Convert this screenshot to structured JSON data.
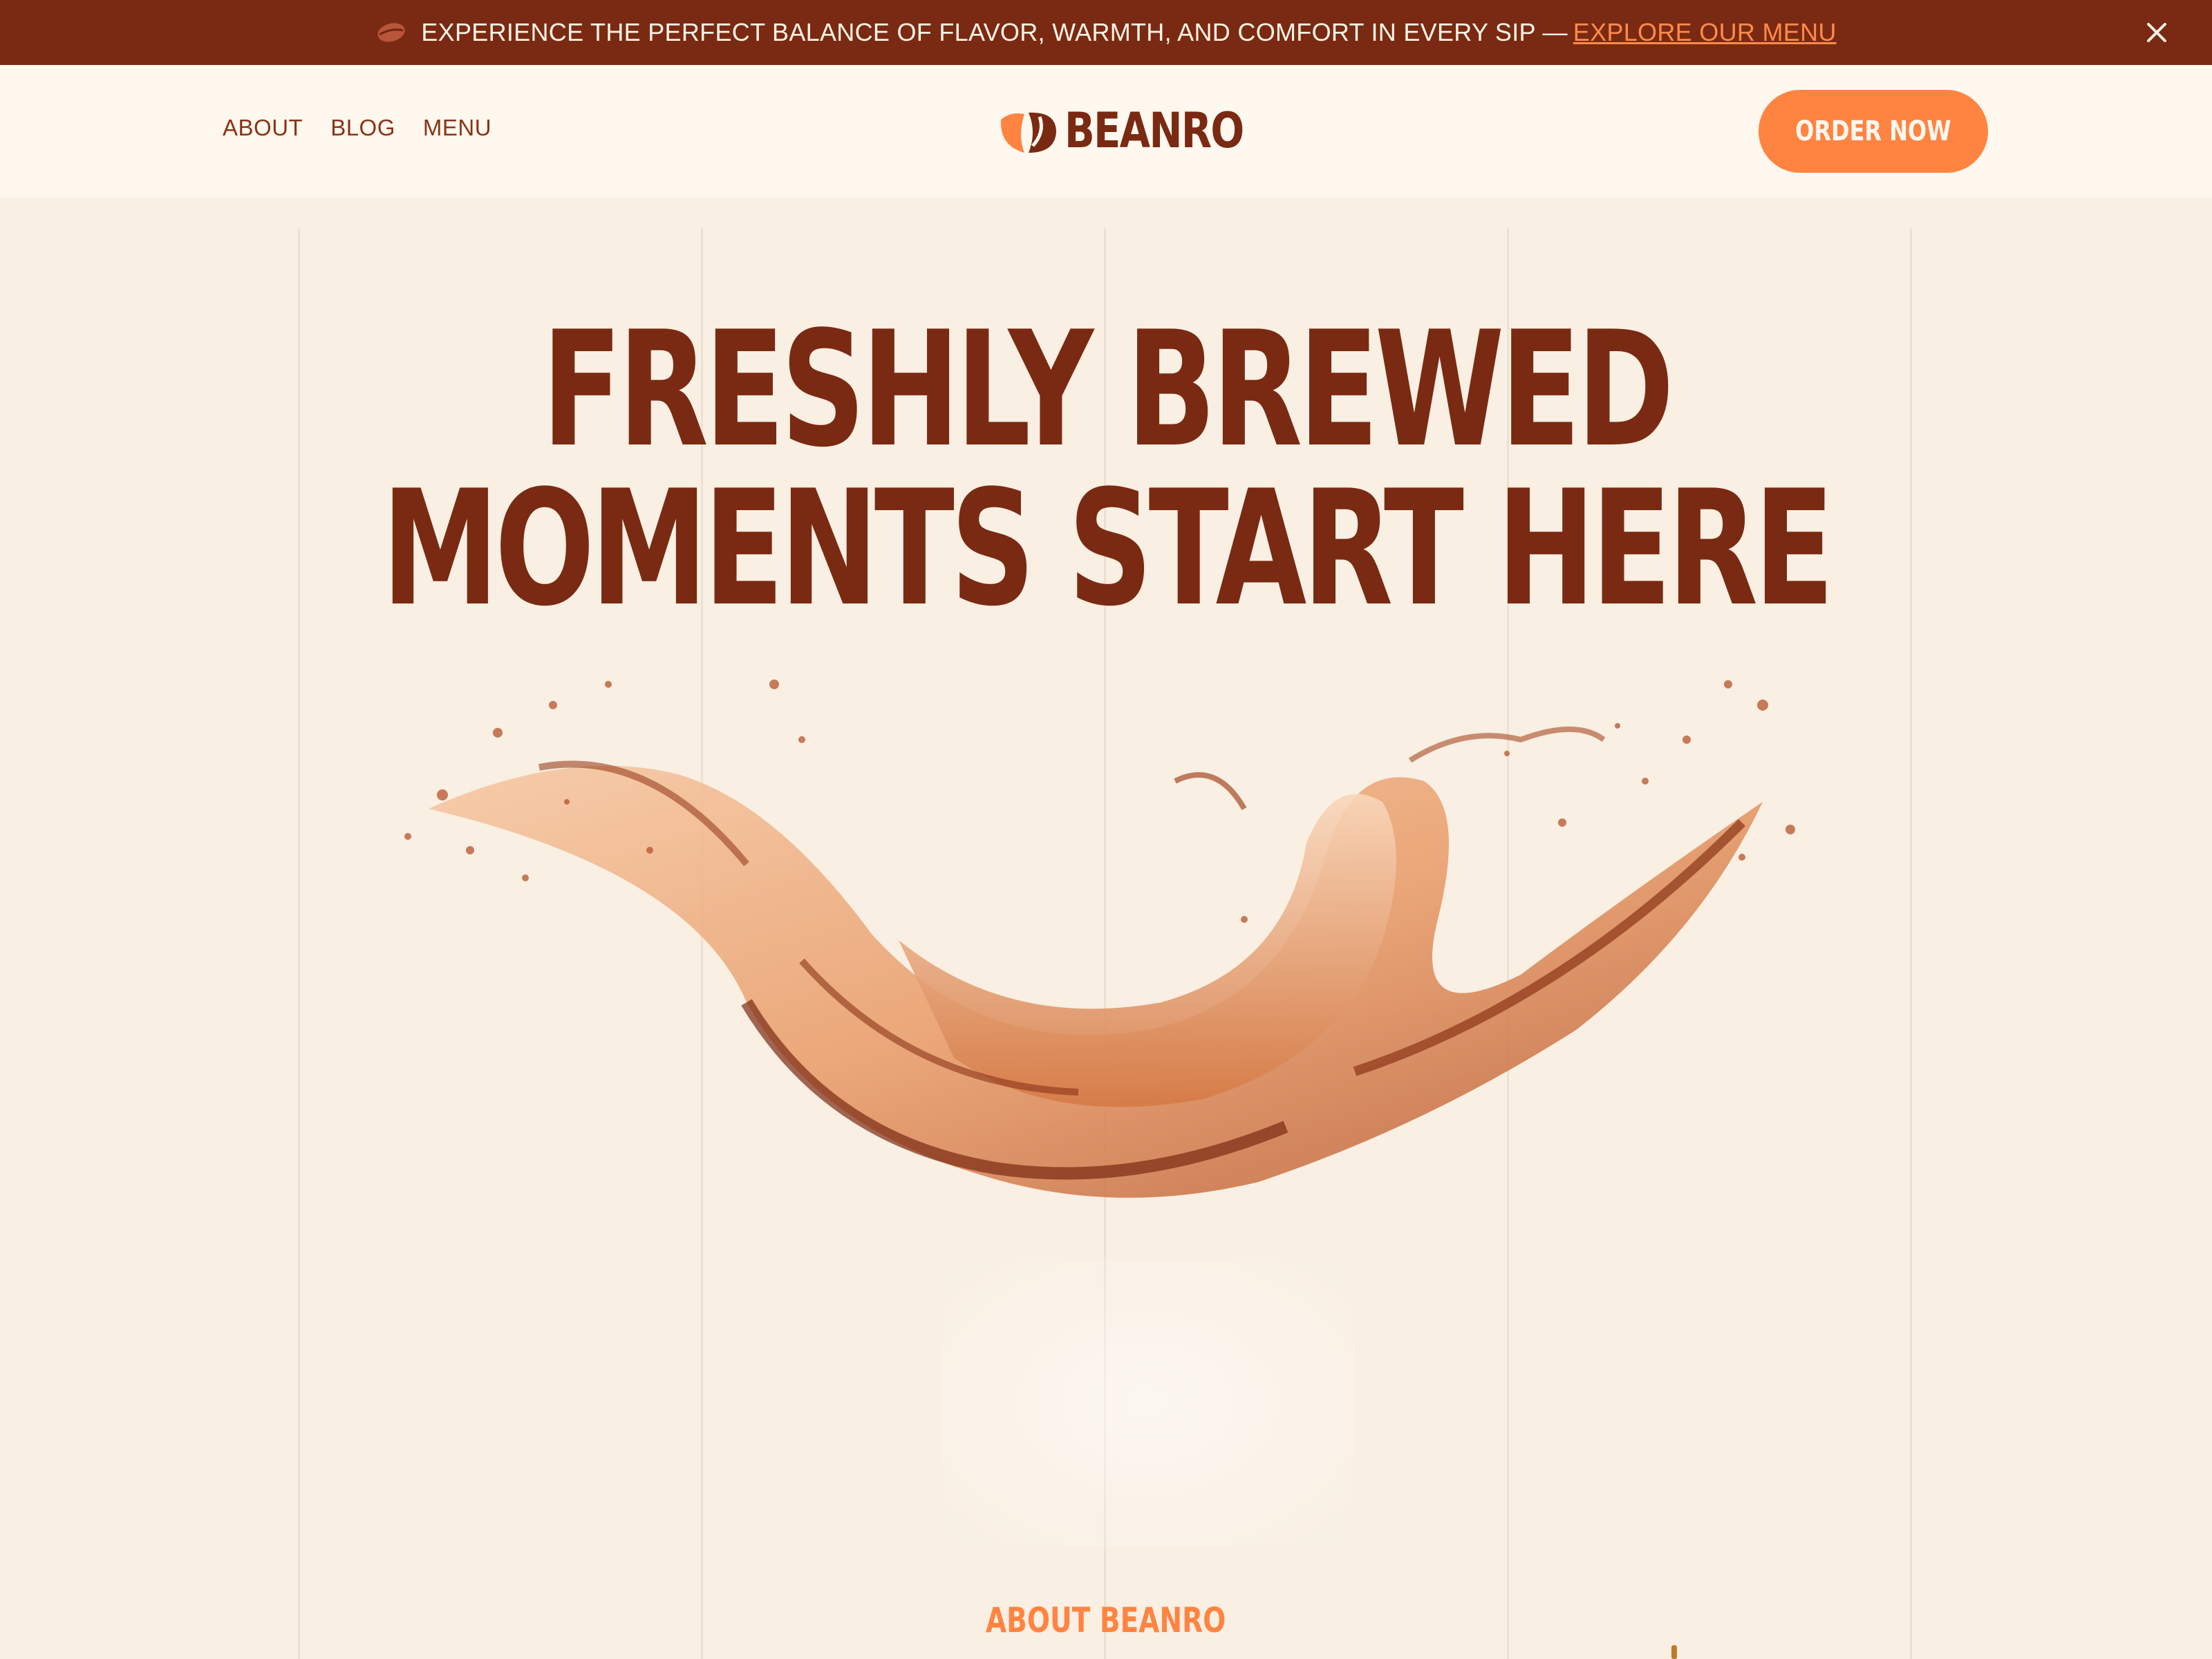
{
  "announcement": {
    "text": "EXPERIENCE THE PERFECT BALANCE OF FLAVOR, WARMTH, AND COMFORT IN EVERY SIP —",
    "link_label": "EXPLORE OUR MENU",
    "bean_icon": "coffee-bean-icon",
    "close_icon": "close-icon"
  },
  "header": {
    "nav": [
      {
        "label": "ABOUT"
      },
      {
        "label": "BLOG"
      },
      {
        "label": "MENU"
      }
    ],
    "logo_text": "BEANRO",
    "order_button": "ORDER NOW"
  },
  "hero": {
    "headline_line1": "FRESHLY BREWED",
    "headline_line2": "MOMENTS START HERE",
    "image": "coffee-splash"
  },
  "section": {
    "label": "ABOUT BEANRO"
  },
  "colors": {
    "primary": "#7a2a12",
    "accent": "#ff8441",
    "background": "#f9efe3",
    "header_background": "#fef8ef"
  }
}
